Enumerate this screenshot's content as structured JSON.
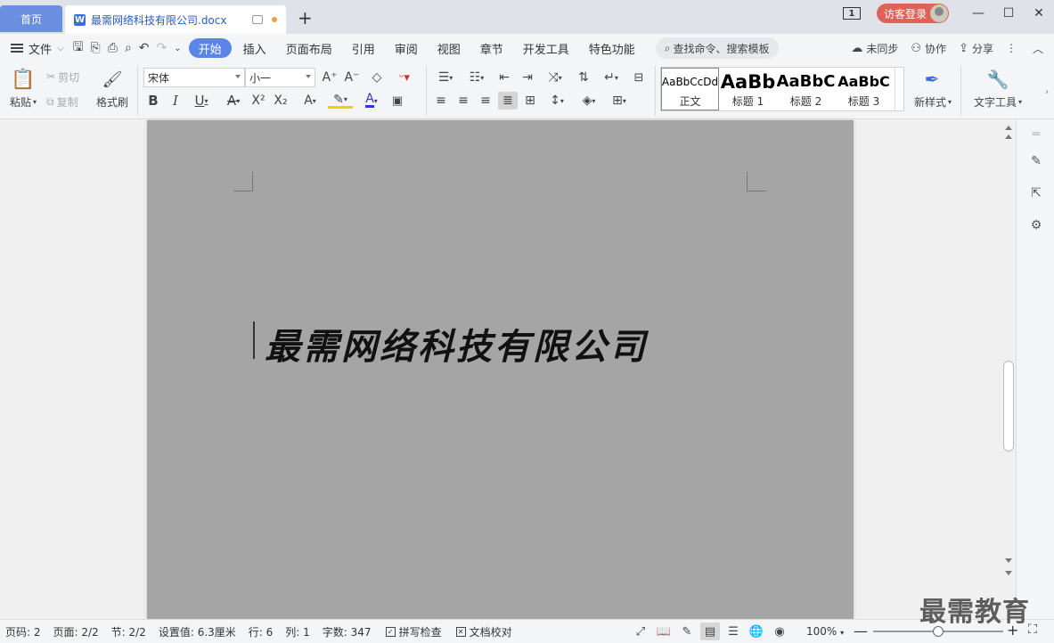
{
  "titlebar": {
    "home_tab": "首页",
    "doc_tab_icon": "W",
    "doc_tab": "最需网络科技有限公司.docx",
    "page_badge": "1",
    "login": "访客登录"
  },
  "menubar": {
    "file": "文件",
    "tabs": [
      "开始",
      "插入",
      "页面布局",
      "引用",
      "审阅",
      "视图",
      "章节",
      "开发工具",
      "特色功能"
    ],
    "search": "查找命令、搜索模板",
    "sync": "未同步",
    "collab": "协作",
    "share": "分享"
  },
  "ribbon": {
    "paste": "粘贴",
    "cut": "剪切",
    "copy": "复制",
    "format_painter": "格式刷",
    "font_name": "宋体",
    "font_size": "小一",
    "styles": [
      {
        "preview": "AaBbCcDd",
        "name": "正文"
      },
      {
        "preview": "AaBb",
        "name": "标题 1"
      },
      {
        "preview": "AaBbC",
        "name": "标题 2"
      },
      {
        "preview": "AaBbC",
        "name": "标题 3"
      }
    ],
    "new_style": "新样式",
    "text_tools": "文字工具"
  },
  "document": {
    "heading": "最需网络科技有限公司"
  },
  "statusbar": {
    "page_num": "页码: 2",
    "pages": "页面: 2/2",
    "section": "节: 2/2",
    "setting": "设置值: 6.3厘米",
    "row": "行: 6",
    "col": "列: 1",
    "words": "字数: 347",
    "spell": "拼写检查",
    "proof": "文档校对",
    "zoom": "100%",
    "zoom_level": 0.5
  },
  "watermark": "最需教育",
  "colors": {
    "accent": "#5b86e5",
    "home_tab": "#6b8fe0",
    "login": "#e06158",
    "page": "#a5a5a5"
  }
}
